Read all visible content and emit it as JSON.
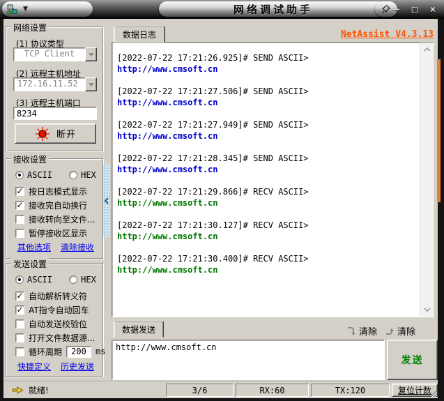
{
  "titlebar": {
    "title": "网络调试助手",
    "menu_arrow": "▼",
    "minimize": "−",
    "maximize": "□",
    "close": "×"
  },
  "header": {
    "version_link": "NetAssist V4.3.13"
  },
  "network_settings": {
    "title": "网络设置",
    "protocol_label": "(1) 协议类型",
    "protocol_value": "TCP Client",
    "host_label": "(2) 远程主机地址",
    "host_value": "172.16.11.52",
    "port_label": "(3) 远程主机端口",
    "port_value": "8234",
    "disconnect_label": "断开"
  },
  "receive_settings": {
    "title": "接收设置",
    "radio_ascii": "ASCII",
    "radio_hex": "HEX",
    "radio_selected": "ASCII",
    "options": [
      {
        "label": "按日志模式显示",
        "checked": true
      },
      {
        "label": "接收完自动换行",
        "checked": true
      },
      {
        "label": "接收转向至文件...",
        "checked": false
      },
      {
        "label": "暂停接收区显示",
        "checked": false
      }
    ],
    "link_other": "其他选项",
    "link_clear": "清除接收"
  },
  "send_settings": {
    "title": "发送设置",
    "radio_ascii": "ASCII",
    "radio_hex": "HEX",
    "radio_selected": "ASCII",
    "options": [
      {
        "label": "自动解析转义符",
        "checked": true
      },
      {
        "label": "AT指令自动回车",
        "checked": true
      },
      {
        "label": "自动发送校验位",
        "checked": false
      },
      {
        "label": "打开文件数据源...",
        "checked": false
      }
    ],
    "cycle": {
      "checked": false,
      "label": "循环周期",
      "value": "200",
      "unit": "ms"
    },
    "link_shortcut": "快捷定义",
    "link_history": "历史发送"
  },
  "log": {
    "tab_label": "数据日志",
    "entries": [
      {
        "header": "[2022-07-22 17:21:26.925]# SEND ASCII>",
        "data": "http://www.cmsoft.cn",
        "type": "send"
      },
      {
        "header": "[2022-07-22 17:21:27.506]# SEND ASCII>",
        "data": "http://www.cmsoft.cn",
        "type": "send"
      },
      {
        "header": "[2022-07-22 17:21:27.949]# SEND ASCII>",
        "data": "http://www.cmsoft.cn",
        "type": "send"
      },
      {
        "header": "[2022-07-22 17:21:28.345]# SEND ASCII>",
        "data": "http://www.cmsoft.cn",
        "type": "send"
      },
      {
        "header": "[2022-07-22 17:21:29.866]# RECV ASCII>",
        "data": "http://www.cmsoft.cn",
        "type": "recv"
      },
      {
        "header": "[2022-07-22 17:21:30.127]# RECV ASCII>",
        "data": "http://www.cmsoft.cn",
        "type": "recv"
      },
      {
        "header": "[2022-07-22 17:21:30.400]# RECV ASCII>",
        "data": "http://www.cmsoft.cn",
        "type": "recv"
      }
    ]
  },
  "send_area": {
    "tab_label": "数据发送",
    "clear_recv_label": "清除",
    "clear_send_label": "清除",
    "input_value": "http://www.cmsoft.cn",
    "send_button": "发送"
  },
  "status_bar": {
    "ready": "就绪!",
    "packets": "3/6",
    "rx": "RX:60",
    "tx": "TX:120",
    "reset_label": "复位计数"
  },
  "colors": {
    "accent_orange": "#FF5500",
    "link_blue": "#0000EE",
    "send_text_blue": "#0000CC",
    "recv_text_green": "#007700",
    "send_button_green": "#008000",
    "scroll_thumb_orange": "#E0803C"
  }
}
